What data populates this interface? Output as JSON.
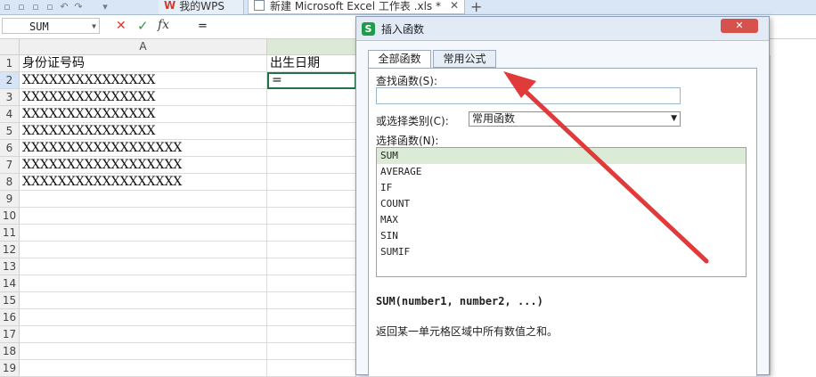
{
  "toolbar": {
    "tab_wps_icon": "W",
    "tab_wps_label": "我的WPS",
    "tab_doc_label": "新建 Microsoft Excel 工作表 .xls *",
    "tab_close": "✕",
    "add_tab": "+"
  },
  "formula_bar": {
    "name_box": "SUM",
    "cancel": "✕",
    "confirm": "✓",
    "fx": "fx",
    "content": "="
  },
  "sheet": {
    "col_a": "A",
    "rows": [
      "1",
      "2",
      "3",
      "4",
      "5",
      "6",
      "7",
      "8",
      "9",
      "10",
      "11",
      "12",
      "13",
      "14",
      "15",
      "16",
      "17",
      "18",
      "19"
    ],
    "a1": "身份证号码",
    "b1": "出生日期",
    "b2": "=",
    "ids": [
      "XXXXXXXXXXXXXXX",
      "XXXXXXXXXXXXXXX",
      "XXXXXXXXXXXXXXX",
      "XXXXXXXXXXXXXXX",
      "XXXXXXXXXXXXXXXXXX",
      "XXXXXXXXXXXXXXXXXX",
      "XXXXXXXXXXXXXXXXXX"
    ]
  },
  "dialog": {
    "logo": "S",
    "title": "插入函数",
    "tabs": [
      "全部函数",
      "常用公式"
    ],
    "search_label": "查找函数(S):",
    "category_label": "或选择类别(C):",
    "category_value": "常用函数",
    "select_label": "选择函数(N):",
    "functions": [
      "SUM",
      "AVERAGE",
      "IF",
      "COUNT",
      "MAX",
      "SIN",
      "SUMIF"
    ],
    "signature": "SUM(number1, number2, ...)",
    "description": "返回某一单元格区域中所有数值之和。"
  },
  "colors": {
    "accent_green": "#217346",
    "arrow_red": "#e03a3a",
    "selected_row": "#dcebd5"
  }
}
